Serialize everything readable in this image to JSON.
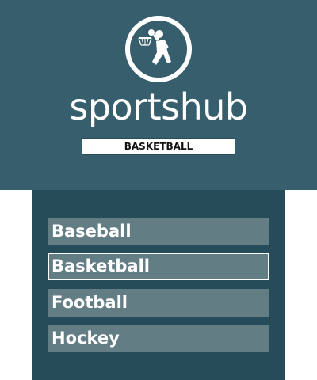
{
  "app": {
    "brand": "sportshub",
    "logo_icon": "basketball-player-icon",
    "selected_sport": "BASKETBALL"
  },
  "colors": {
    "header_bg": "#365e6c",
    "panel_bg": "#264c59",
    "item_bg": "#637d85",
    "text": "#ffffff"
  },
  "menu": {
    "items": [
      {
        "label": "Baseball",
        "active": false
      },
      {
        "label": "Basketball",
        "active": true
      },
      {
        "label": "Football",
        "active": false
      },
      {
        "label": "Hockey",
        "active": false
      }
    ]
  }
}
